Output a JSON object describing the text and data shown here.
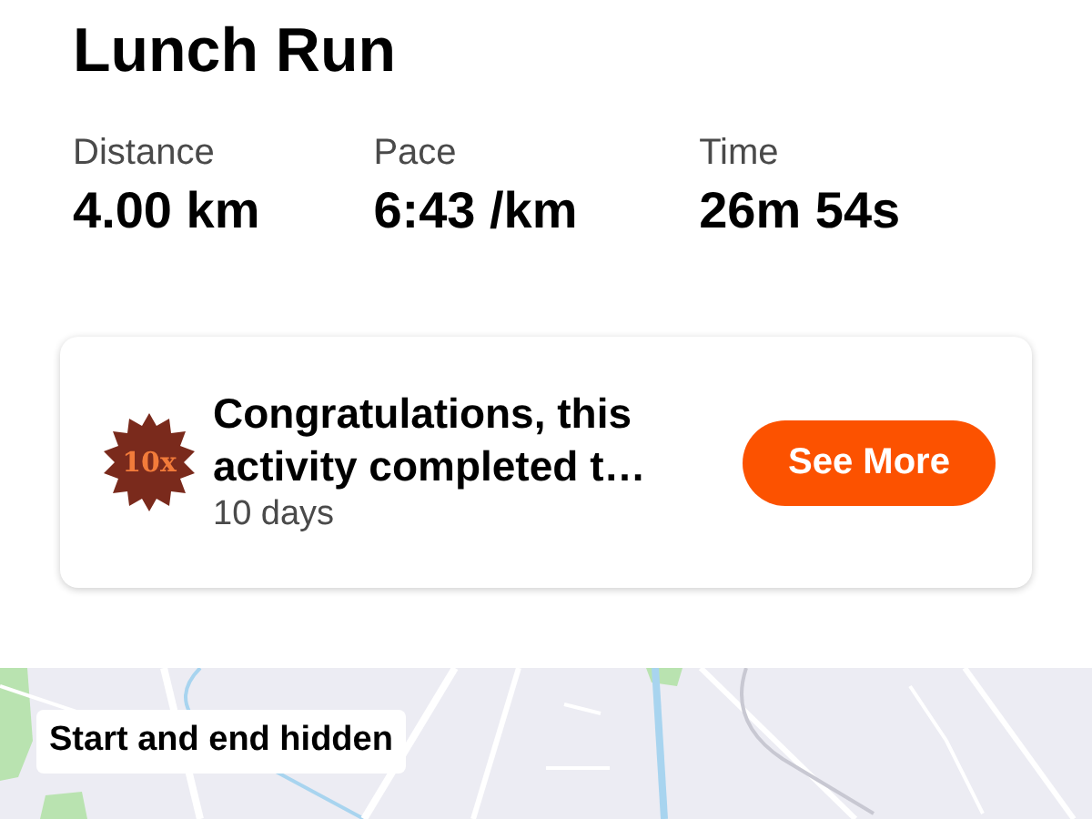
{
  "title": "Lunch Run",
  "stats": [
    {
      "label": "Distance",
      "value": "4.00 km"
    },
    {
      "label": "Pace",
      "value": "6:43 /km"
    },
    {
      "label": "Time",
      "value": "26m 54s"
    }
  ],
  "achievement": {
    "badge": "10x",
    "headline": "Congratulations, this activity completed t…",
    "subtitle": "10 days",
    "button": "See More"
  },
  "map": {
    "kind": "picture",
    "notice": "Start and end hidden"
  }
}
